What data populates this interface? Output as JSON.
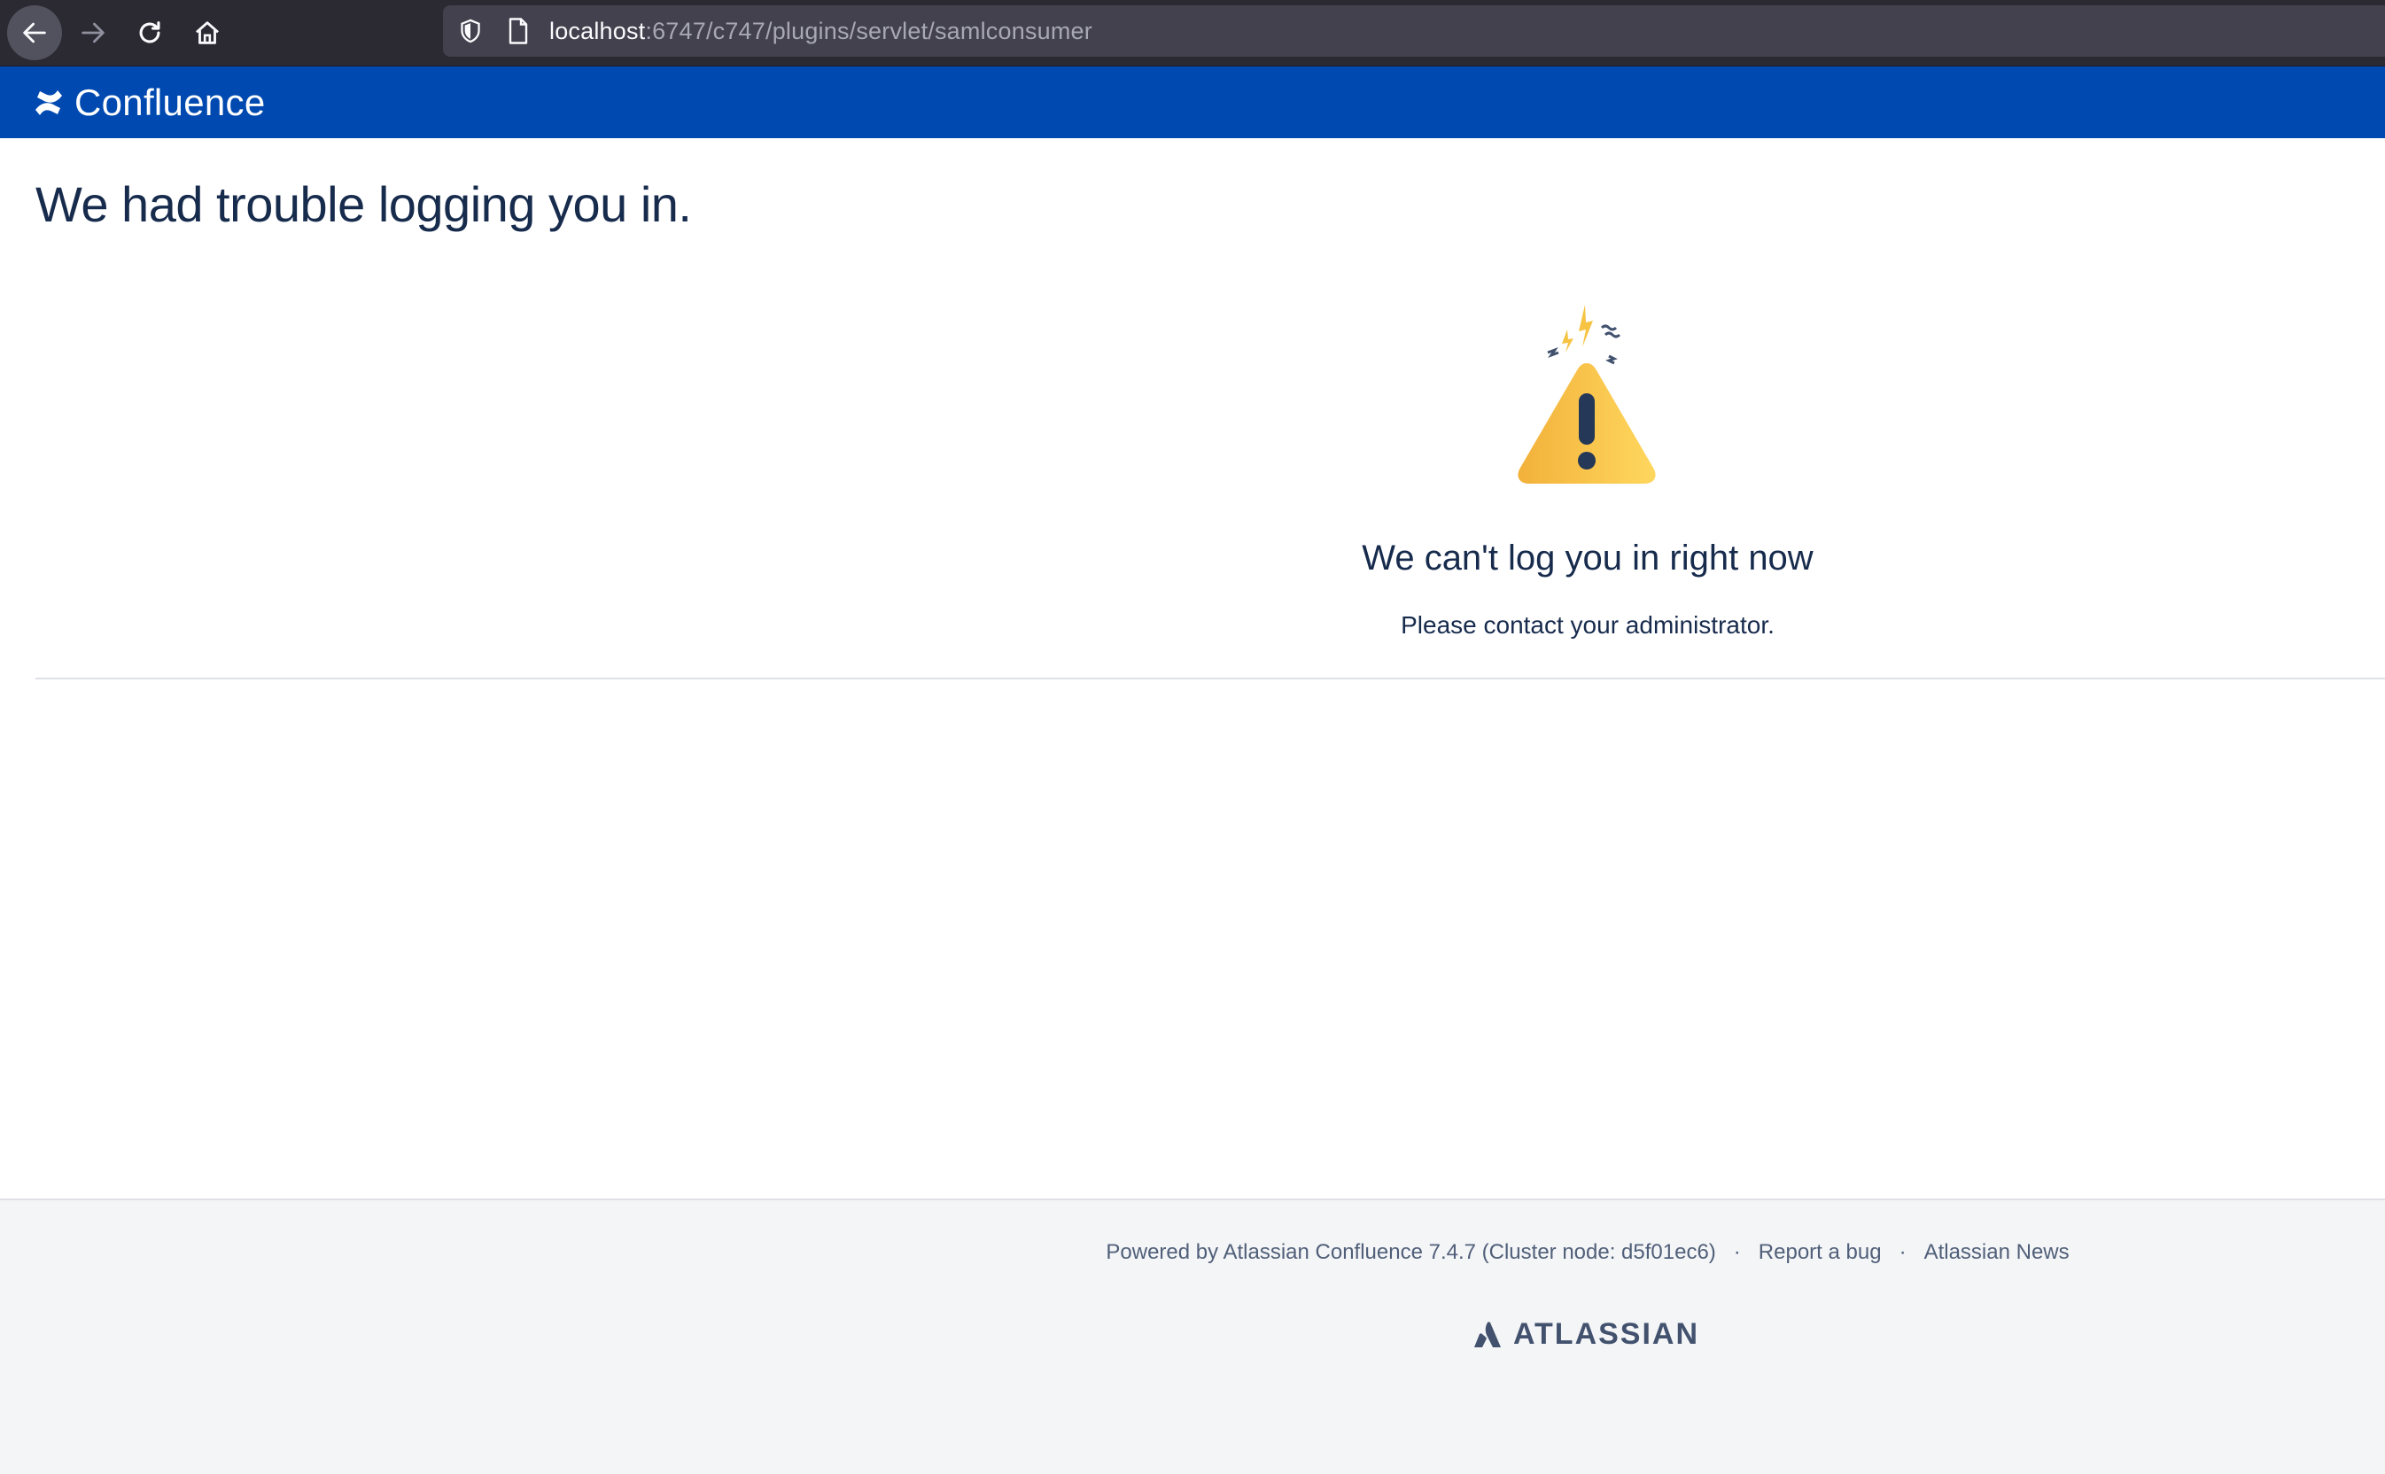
{
  "browser": {
    "url_host": "localhost",
    "url_path": ":6747/c747/plugins/servlet/samlconsumer"
  },
  "header": {
    "logo_text": "Confluence"
  },
  "main": {
    "title": "We had trouble logging you in.",
    "error_heading": "We can't log you in right now",
    "error_message": "Please contact your administrator."
  },
  "footer": {
    "powered_by": "Powered by Atlassian Confluence 7.4.7 (Cluster node: d5f01ec6)",
    "separator": "·",
    "report_bug": "Report a bug",
    "atlassian_news": "Atlassian News",
    "atlassian_logo_text": "ATLASSIAN"
  },
  "icons": {
    "back": "arrow-left-icon",
    "forward": "arrow-right-icon",
    "reload": "reload-icon",
    "home": "home-icon",
    "shield": "shield-icon",
    "page": "page-icon",
    "confluence": "confluence-logo-icon",
    "warning": "warning-triangle-icon",
    "atlassian": "atlassian-logo-icon"
  },
  "colors": {
    "brand_header": "#0049b0",
    "title_text": "#172b4d",
    "footer_bg": "#f4f5f7",
    "footer_text": "#505f79",
    "warning_yellow": "#f6c342"
  }
}
